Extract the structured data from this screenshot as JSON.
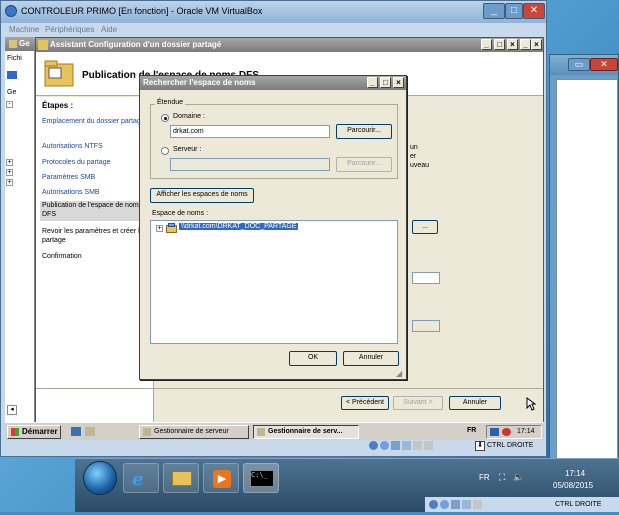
{
  "vbox": {
    "title": "CONTROLEUR PRIMO [En fonction] - Oracle VM VirtualBox",
    "menu": [
      "Machine",
      "Périphériques",
      "Aide"
    ],
    "host_key": "CTRL DROITE"
  },
  "server_manager": {
    "title_fragment": "Ge",
    "menu_fragment": "Fichi",
    "tree_fragment": "Ge"
  },
  "wizard": {
    "title": "Assistant Configuration d'un dossier partagé",
    "header": "Publication de l'espace de noms DFS",
    "steps_title": "Étapes :",
    "steps": [
      "Emplacement du dossier partagé",
      "Autorisations NTFS",
      "Protocoles du partage",
      "Paramètres SMB",
      "Autorisations SMB",
      "Publication de l'espace de noms DFS",
      "Revoir les paramètres et créer le partage",
      "Confirmation"
    ],
    "active_step": 5,
    "body_fragments": [
      "un",
      "er",
      "uveau"
    ],
    "buttons": {
      "prev": "< Précédent",
      "next": "Suivant >",
      "cancel": "Annuler"
    }
  },
  "dialog": {
    "title": "Rechercher l'espace de noms",
    "scope_label": "Étendue",
    "domain_label": "Domaine :",
    "domain_value": "drkat.com",
    "browse_label": "Parcourir...",
    "server_label": "Serveur :",
    "server_value": "",
    "show_button": "Afficher les espaces de noms",
    "namespace_label": "Espace de noms :",
    "namespace_item": "\\\\drkat.com\\DRKAT_DOC_PARTAGE",
    "ok": "OK",
    "cancel": "Annuler",
    "scope_selected": "domain"
  },
  "guest_taskbar": {
    "start": "Démarrer",
    "tasks": [
      "Gestionnaire de serveur",
      "Gestionnaire de serv..."
    ],
    "lang": "FR",
    "time": "17:14"
  },
  "host_taskbar": {
    "lang": "FR",
    "time": "17:14",
    "date": "05/08/2015",
    "host_key": "CTRL DROITE",
    "apps": [
      "windows-start",
      "internet-explorer",
      "file-explorer",
      "media-player",
      "command-prompt"
    ]
  },
  "colors": {
    "xp_selection": "#316ac5",
    "link_blue": "#1a4aa0",
    "host_desktop": "#3c88c0"
  }
}
